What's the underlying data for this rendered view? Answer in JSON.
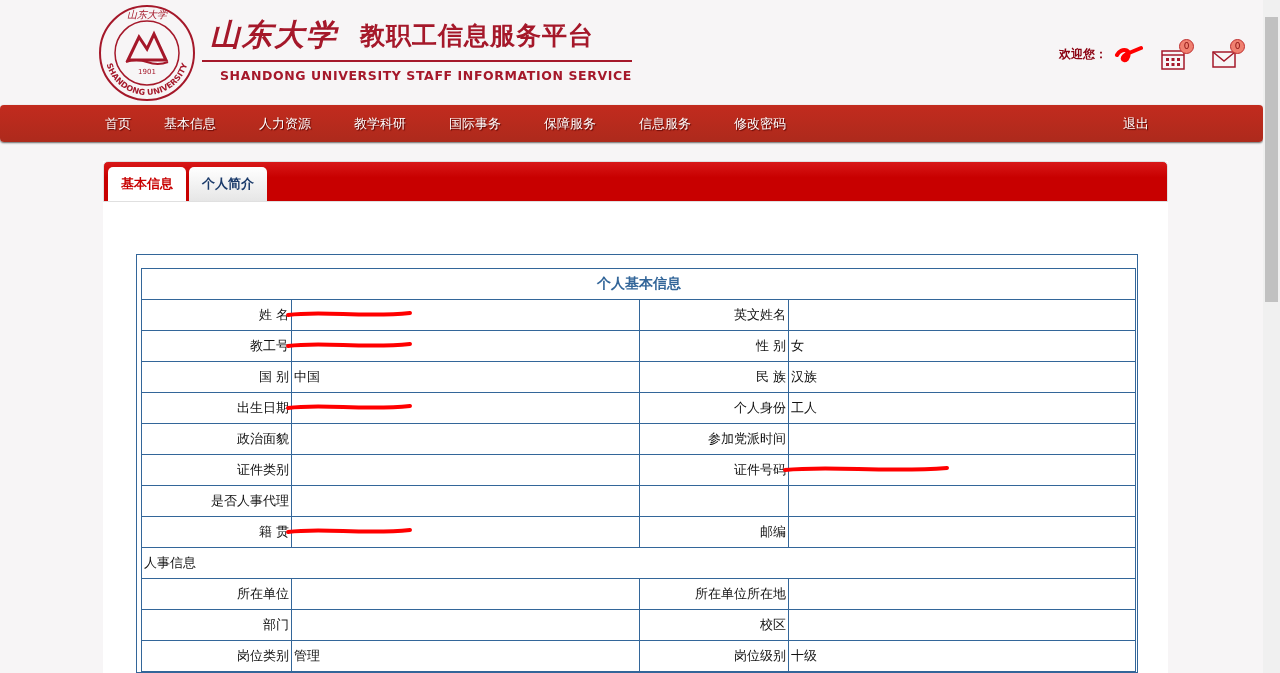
{
  "logo": {
    "seal_top": "山东大学",
    "seal_year": "1901",
    "seal_bottom": "SHANDONG UNIVERSITY",
    "calligraphy": "山东大学",
    "title": "教职工信息服务平台",
    "subtitle": "SHANDONG UNIVERSITY STAFF INFORMATION SERVICE"
  },
  "user": {
    "welcome": "欢迎您：",
    "name_redacted": true,
    "calendar_count": "0",
    "mail_count": "0"
  },
  "nav": [
    {
      "label": "首页"
    },
    {
      "label": "基本信息"
    },
    {
      "label": "人力资源"
    },
    {
      "label": "教学科研"
    },
    {
      "label": "国际事务"
    },
    {
      "label": "保障服务"
    },
    {
      "label": "信息服务"
    },
    {
      "label": "修改密码"
    },
    {
      "label": "退出",
      "kind": "right"
    }
  ],
  "tabs": [
    {
      "label": "基本信息",
      "selected": true
    },
    {
      "label": "个人简介",
      "selected": false
    }
  ],
  "table": {
    "title": "个人基本信息",
    "rows": [
      {
        "kind": "pair",
        "cells": [
          {
            "label": "姓 名",
            "redacted": true
          },
          {
            "label": "英文姓名"
          }
        ]
      },
      {
        "kind": "pair",
        "cells": [
          {
            "label": "教工号",
            "redacted": true
          },
          {
            "label": "性 别",
            "value": "女"
          }
        ]
      },
      {
        "kind": "pair",
        "cells": [
          {
            "label": "国 别",
            "value": "中国"
          },
          {
            "label": "民 族",
            "value": "汉族"
          }
        ]
      },
      {
        "kind": "pair",
        "cells": [
          {
            "label": "出生日期",
            "redacted": true
          },
          {
            "label": "个人身份",
            "value": "工人"
          }
        ]
      },
      {
        "kind": "pair",
        "cells": [
          {
            "label": "政治面貌"
          },
          {
            "label": "参加党派时间"
          }
        ]
      },
      {
        "kind": "pair",
        "cells": [
          {
            "label": "证件类别"
          },
          {
            "label": "证件号码",
            "redacted": true
          }
        ]
      },
      {
        "kind": "pair",
        "cells": [
          {
            "label": "是否人事代理"
          },
          {}
        ]
      },
      {
        "kind": "pair",
        "cells": [
          {
            "label": "籍 贯",
            "redacted": true
          },
          {
            "label": "邮编"
          }
        ]
      },
      {
        "kind": "section",
        "title": "人事信息"
      },
      {
        "kind": "pair",
        "cells": [
          {
            "label": "所在单位"
          },
          {
            "label": "所在单位所在地"
          }
        ]
      },
      {
        "kind": "pair",
        "cells": [
          {
            "label": "部门"
          },
          {
            "label": "校区"
          }
        ]
      },
      {
        "kind": "pair",
        "cells": [
          {
            "label": "岗位类别",
            "value": "管理"
          },
          {
            "label": "岗位级别",
            "value": "十级"
          }
        ]
      }
    ]
  }
}
